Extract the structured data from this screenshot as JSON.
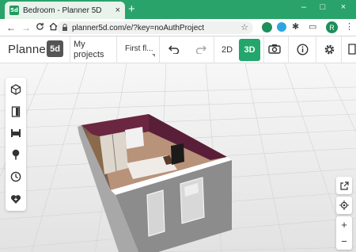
{
  "browser": {
    "tab_title": "Bedroom - Planner 5D",
    "tab_favicon": "5d",
    "tab_close": "×",
    "new_tab": "+",
    "window_controls": {
      "minimize": "–",
      "maximize": "□",
      "close": "×"
    },
    "nav": {
      "back": "←",
      "forward": "→",
      "reload": "C",
      "home": "⌂"
    },
    "url": "planner5d.com/e/?key=noAuthProject",
    "profile_initial": "R"
  },
  "app": {
    "logo_text": "Planner",
    "logo_badge": "5d",
    "my_projects": "My projects",
    "floor_selector": "First fl...",
    "view_2d": "2D",
    "view_3d": "3D",
    "active_view": "3D",
    "accent_color": "#22a66b"
  },
  "left_sidebar": {
    "items": [
      {
        "name": "build-icon",
        "glyph": "⬢"
      },
      {
        "name": "door-icon",
        "glyph": "▯"
      },
      {
        "name": "furniture-icon",
        "glyph": "⌂"
      },
      {
        "name": "exterior-icon",
        "glyph": "♣"
      },
      {
        "name": "history-icon",
        "glyph": "◷"
      },
      {
        "name": "favorites-icon",
        "glyph": "♥"
      }
    ]
  },
  "right_controls": {
    "expand": "⤢",
    "center": "◎",
    "zoom_in": "+",
    "zoom_out": "−"
  }
}
